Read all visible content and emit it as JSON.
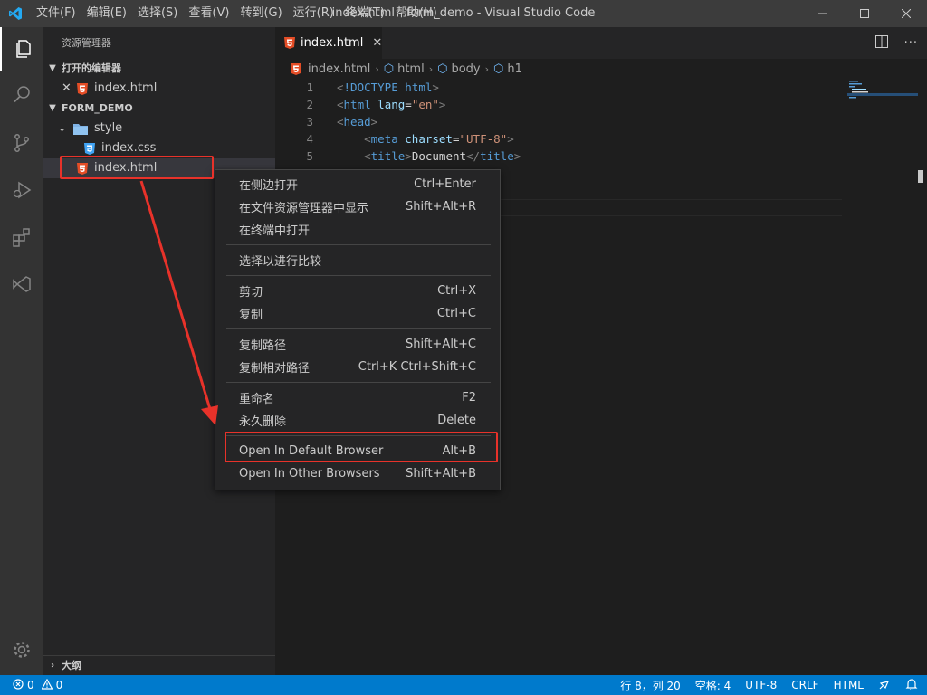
{
  "titlebar": {
    "menu": [
      "文件(F)",
      "编辑(E)",
      "选择(S)",
      "查看(V)",
      "转到(G)",
      "运行(R)",
      "终端(T)",
      "帮助(H)"
    ],
    "title": "index.html - form_demo - Visual Studio Code"
  },
  "sidebar": {
    "title": "资源管理器",
    "open_editors_label": "打开的编辑器",
    "open_file": "index.html",
    "project_label": "FORM_DEMO",
    "folder": "style",
    "css_file": "index.css",
    "html_file": "index.html",
    "outline_label": "大纲"
  },
  "editor": {
    "tab_label": "index.html",
    "breadcrumbs": [
      "index.html",
      "html",
      "body",
      "h1"
    ],
    "line_numbers": [
      "1",
      "2",
      "3",
      "4",
      "5"
    ],
    "code": {
      "l1_doctype": "!DOCTYPE",
      "l1_html": "html",
      "l2_tag": "html",
      "l2_attr": "lang",
      "l2_val": "\"en\"",
      "l3_tag": "head",
      "l4_tag": "meta",
      "l4_attr": "charset",
      "l4_val": "\"UTF-8\"",
      "l5_tag": "title",
      "l5_text": "Document"
    }
  },
  "context_menu": {
    "items": [
      {
        "label": "在侧边打开",
        "shortcut": "Ctrl+Enter"
      },
      {
        "label": "在文件资源管理器中显示",
        "shortcut": "Shift+Alt+R"
      },
      {
        "label": "在终端中打开",
        "shortcut": ""
      },
      {
        "label": "选择以进行比较",
        "shortcut": ""
      },
      {
        "label": "剪切",
        "shortcut": "Ctrl+X"
      },
      {
        "label": "复制",
        "shortcut": "Ctrl+C"
      },
      {
        "label": "复制路径",
        "shortcut": "Shift+Alt+C"
      },
      {
        "label": "复制相对路径",
        "shortcut": "Ctrl+K Ctrl+Shift+C"
      },
      {
        "label": "重命名",
        "shortcut": "F2"
      },
      {
        "label": "永久删除",
        "shortcut": "Delete"
      },
      {
        "label": "Open In Default Browser",
        "shortcut": "Alt+B"
      },
      {
        "label": "Open In Other Browsers",
        "shortcut": "Shift+Alt+B"
      }
    ]
  },
  "statusbar": {
    "errors": "0",
    "warnings": "0",
    "position": "行 8，列 20",
    "spaces": "空格: 4",
    "encoding": "UTF-8",
    "eol": "CRLF",
    "language": "HTML"
  },
  "colors": {
    "accent": "#007acc",
    "annotation_red": "#e8322a",
    "html_icon": "#e44d26",
    "css_icon": "#42a5f5"
  },
  "icons": [
    "vscode-logo-icon",
    "explorer-icon",
    "search-icon",
    "source-control-icon",
    "run-debug-icon",
    "extensions-icon",
    "remote-icon",
    "gear-icon"
  ]
}
